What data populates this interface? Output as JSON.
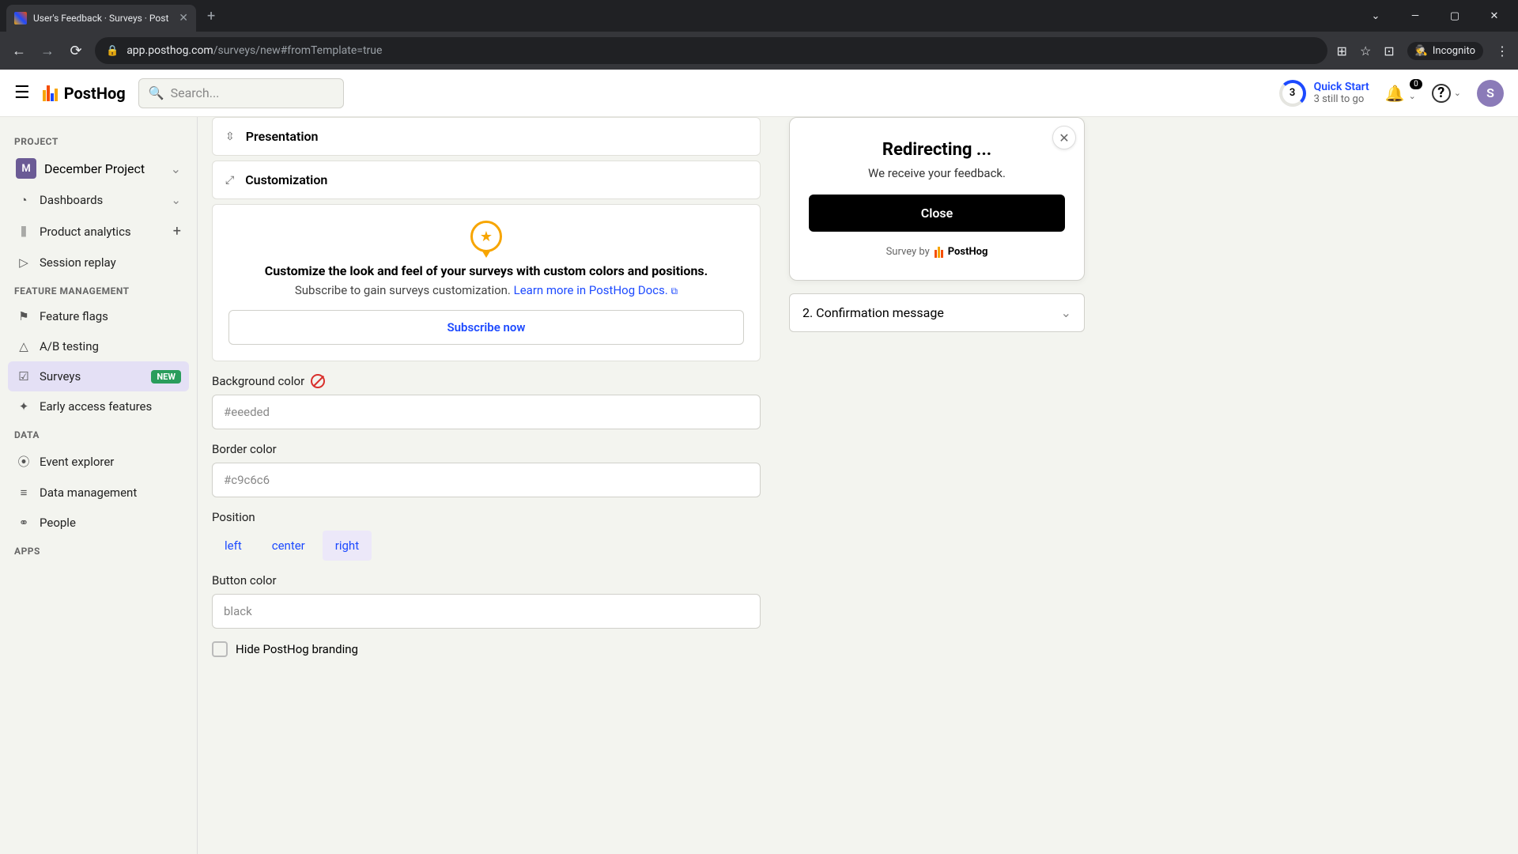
{
  "browser": {
    "tab_title": "User's Feedback · Surveys · Post",
    "url_host": "app.posthog.com",
    "url_path": "/surveys/new#fromTemplate=true",
    "incognito": "Incognito"
  },
  "header": {
    "logo": "PostHog",
    "search_placeholder": "Search...",
    "quickstart_title": "Quick Start",
    "quickstart_sub": "3 still to go",
    "quickstart_num": "3",
    "notif_count": "0",
    "avatar_letter": "S"
  },
  "sidebar": {
    "section_project": "PROJECT",
    "project_letter": "M",
    "project_name": "December Project",
    "items_top": [
      {
        "icon": "◔",
        "label": "Dashboards",
        "chev": true
      },
      {
        "icon": "⫼",
        "label": "Product analytics",
        "plus": true
      },
      {
        "icon": "▷",
        "label": "Session replay"
      }
    ],
    "section_feature": "FEATURE MANAGEMENT",
    "items_feature": [
      {
        "icon": "⚑",
        "label": "Feature flags"
      },
      {
        "icon": "△",
        "label": "A/B testing"
      },
      {
        "icon": "☑",
        "label": "Surveys",
        "badge": "NEW",
        "active": true
      },
      {
        "icon": "✦",
        "label": "Early access features"
      }
    ],
    "section_data": "DATA",
    "items_data": [
      {
        "icon": "⦿",
        "label": "Event explorer"
      },
      {
        "icon": "≡",
        "label": "Data management"
      },
      {
        "icon": "⚭",
        "label": "People"
      }
    ],
    "section_apps": "APPS"
  },
  "main": {
    "section_presentation": "Presentation",
    "section_customization": "Customization",
    "upsell_heading": "Customize the look and feel of your surveys with custom colors and positions.",
    "upsell_text": "Subscribe to gain surveys customization. ",
    "upsell_link": "Learn more in PostHog Docs.",
    "subscribe_btn": "Subscribe now",
    "fields": {
      "bg_label": "Background color",
      "bg_value": "#eeeded",
      "border_label": "Border color",
      "border_value": "#c9c6c6",
      "position_label": "Position",
      "pos_left": "left",
      "pos_center": "center",
      "pos_right": "right",
      "button_label": "Button color",
      "button_value": "black",
      "hide_branding": "Hide PostHog branding"
    }
  },
  "preview": {
    "title": "Redirecting ...",
    "subtitle": "We receive your feedback.",
    "close_btn": "Close",
    "brand_prefix": "Survey by",
    "brand_name": "PostHog",
    "confirm_label": "2. Confirmation message"
  }
}
